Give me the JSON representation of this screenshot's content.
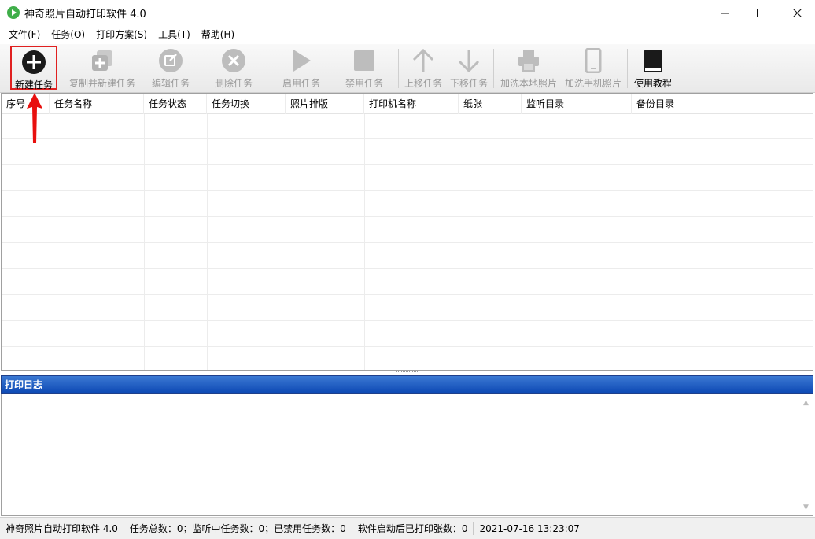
{
  "window": {
    "title": "神奇照片自动打印软件 4.0",
    "minimize_glyph": "—",
    "maximize_glyph": "☐",
    "close_glyph": "✕"
  },
  "menu": [
    "文件(F)",
    "任务(O)",
    "打印方案(S)",
    "工具(T)",
    "帮助(H)"
  ],
  "toolbar": {
    "new_task": "新建任务",
    "copy_new_task": "复制并新建任务",
    "edit_task": "编辑任务",
    "delete_task": "删除任务",
    "enable_task": "启用任务",
    "disable_task": "禁用任务",
    "move_up": "上移任务",
    "move_down": "下移任务",
    "add_local_photo": "加洗本地照片",
    "add_phone_photo": "加洗手机照片",
    "tutorial": "使用教程"
  },
  "grid": {
    "columns": [
      "序号",
      "任务名称",
      "任务状态",
      "任务切换",
      "照片排版",
      "打印机名称",
      "纸张",
      "监听目录",
      "备份目录"
    ],
    "rows": []
  },
  "log": {
    "title": "打印日志",
    "scroll_up": "▲",
    "scroll_down": "▼"
  },
  "status": {
    "app_name": "神奇照片自动打印软件 4.0",
    "task_counts": "任务总数：0；监听中任务数：0；已禁用任务数：0",
    "printed_count": "软件启动后已打印张数：0",
    "datetime": "2021-07-16 13:23:07"
  },
  "colors": {
    "log_header": "#0d48b4",
    "highlight_border": "#e02020",
    "annotation_arrow": "#e8100e"
  }
}
